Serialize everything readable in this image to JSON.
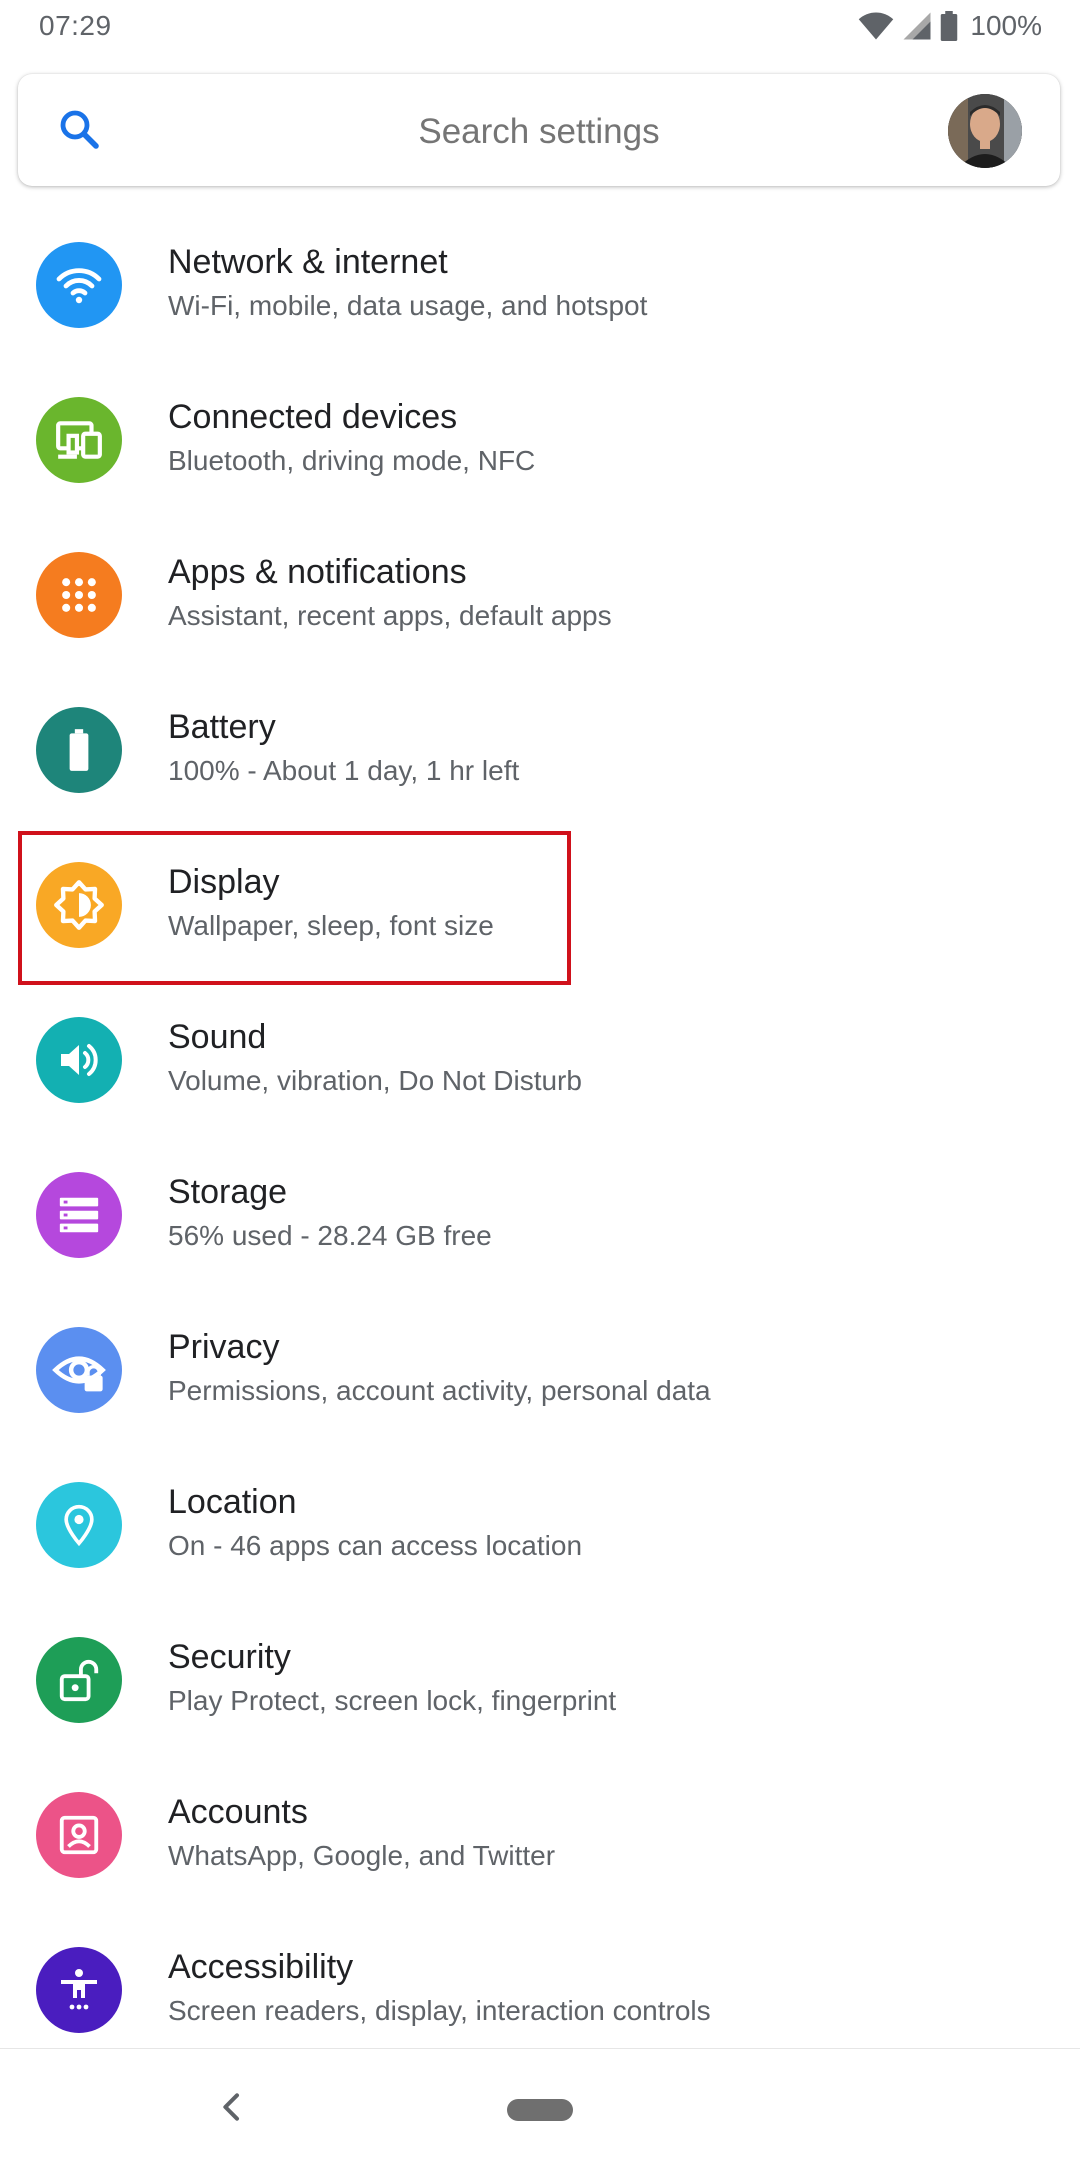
{
  "status_bar": {
    "time": "07:29",
    "battery_percent": "100%",
    "icons": [
      "wifi-icon",
      "cell-signal-icon",
      "battery-icon"
    ]
  },
  "search": {
    "placeholder": "Search settings",
    "icon": "search-icon",
    "accent_color": "#1a73e8"
  },
  "settings": [
    {
      "id": "network",
      "title": "Network & internet",
      "subtitle": "Wi-Fi, mobile, data usage, and hotspot",
      "icon": "wifi-icon",
      "color": "#2196f3"
    },
    {
      "id": "connected",
      "title": "Connected devices",
      "subtitle": "Bluetooth, driving mode, NFC",
      "icon": "devices-icon",
      "color": "#6ab62d"
    },
    {
      "id": "apps",
      "title": "Apps & notifications",
      "subtitle": "Assistant, recent apps, default apps",
      "icon": "apps-grid-icon",
      "color": "#f57c1f"
    },
    {
      "id": "battery",
      "title": "Battery",
      "subtitle": "100% - About 1 day, 1 hr left",
      "icon": "battery-icon",
      "color": "#1e857a"
    },
    {
      "id": "display",
      "title": "Display",
      "subtitle": "Wallpaper, sleep, font size",
      "icon": "brightness-icon",
      "color": "#f9a825"
    },
    {
      "id": "sound",
      "title": "Sound",
      "subtitle": "Volume, vibration, Do Not Disturb",
      "icon": "volume-icon",
      "color": "#13b0b2"
    },
    {
      "id": "storage",
      "title": "Storage",
      "subtitle": "56% used - 28.24 GB free",
      "icon": "storage-icon",
      "color": "#b548dd"
    },
    {
      "id": "privacy",
      "title": "Privacy",
      "subtitle": "Permissions, account activity, personal data",
      "icon": "eye-lock-icon",
      "color": "#5b8ff0"
    },
    {
      "id": "location",
      "title": "Location",
      "subtitle": "On - 46 apps can access location",
      "icon": "location-pin-icon",
      "color": "#2bc6dd"
    },
    {
      "id": "security",
      "title": "Security",
      "subtitle": "Play Protect, screen lock, fingerprint",
      "icon": "unlock-icon",
      "color": "#1e9e57"
    },
    {
      "id": "accounts",
      "title": "Accounts",
      "subtitle": "WhatsApp, Google, and Twitter",
      "icon": "account-box-icon",
      "color": "#ec5388"
    },
    {
      "id": "accessibility",
      "title": "Accessibility",
      "subtitle": "Screen readers, display, interaction controls",
      "icon": "accessibility-icon",
      "color": "#4a1dbf"
    }
  ],
  "highlight": {
    "target": "display",
    "color": "#d0111b"
  },
  "nav_bar": {
    "icons": [
      "back-icon",
      "home-pill-icon"
    ]
  }
}
